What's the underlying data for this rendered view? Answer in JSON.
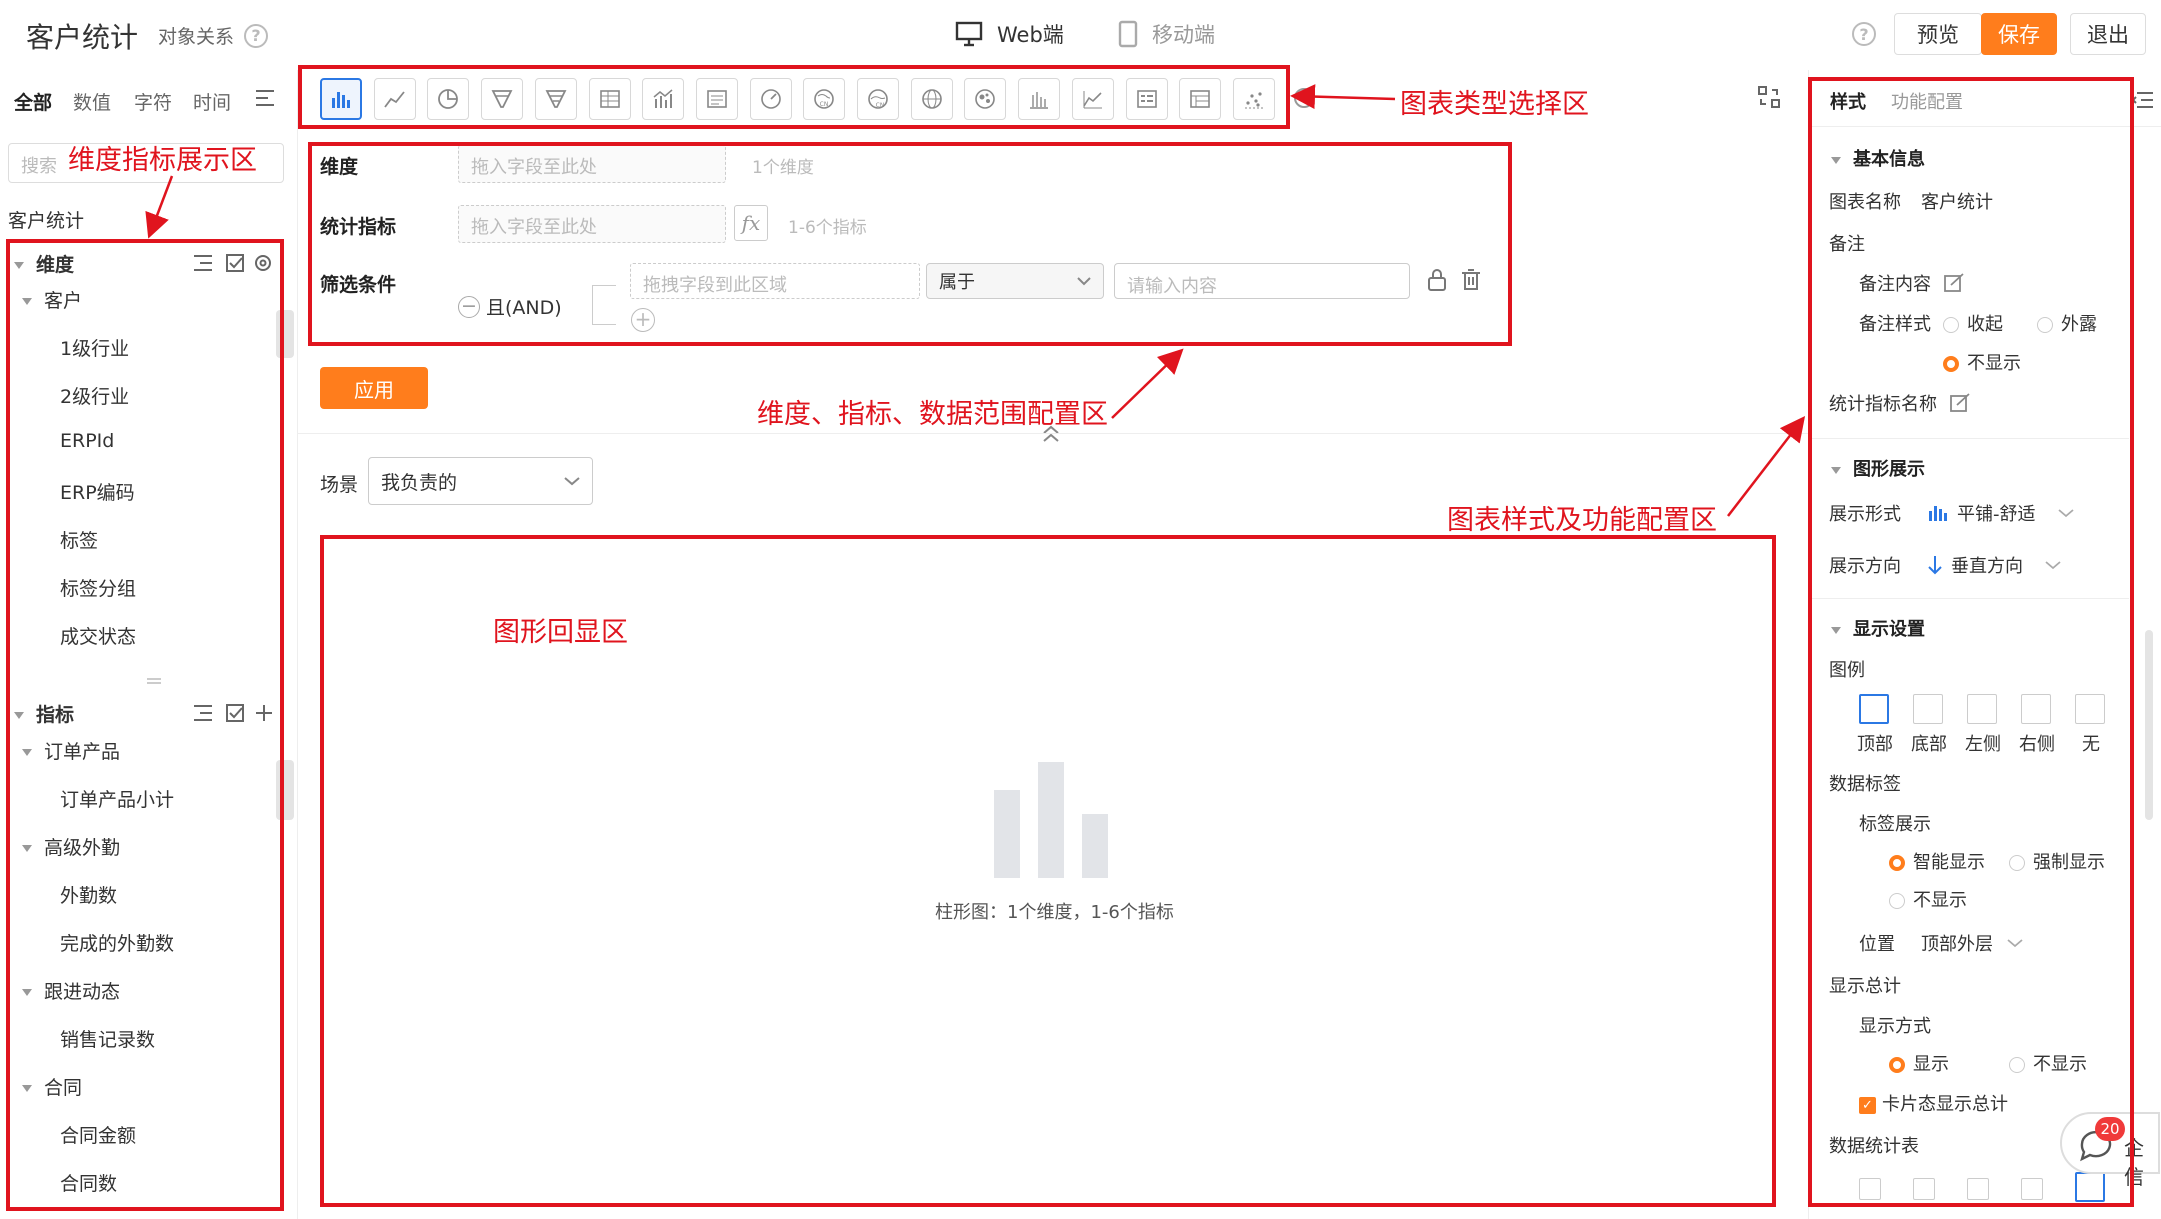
{
  "header": {
    "title": "客户统计",
    "subtitle": "对象关系",
    "device_tabs": [
      {
        "label": "Web端"
      },
      {
        "label": "移动端"
      }
    ],
    "buttons": {
      "preview": "预览",
      "save": "保存",
      "exit": "退出"
    }
  },
  "left": {
    "tabs": [
      "全部",
      "数值",
      "字符",
      "时间"
    ],
    "search_placeholder": "搜索",
    "object_name": "客户统计",
    "dimension_header": "维度",
    "dimension_groups": [
      {
        "label": "客户",
        "items": [
          "1级行业",
          "2级行业",
          "ERPId",
          "ERP编码",
          "标签",
          "标签分组",
          "成交状态"
        ]
      }
    ],
    "metric_header": "指标",
    "metric_groups": [
      {
        "label": "订单产品",
        "items": [
          "订单产品小计"
        ]
      },
      {
        "label": "高级外勤",
        "items": [
          "外勤数",
          "完成的外勤数"
        ]
      },
      {
        "label": "跟进动态",
        "items": [
          "销售记录数"
        ]
      },
      {
        "label": "合同",
        "items": [
          "合同金额",
          "合同数"
        ]
      }
    ]
  },
  "chart_types": [
    "bar-chart-icon",
    "line-chart-icon",
    "pie-chart-icon",
    "funnel-icon",
    "funnel-alt-icon",
    "table-icon",
    "combo-chart-icon",
    "card-icon",
    "gauge-icon",
    "map-cn-icon",
    "map-cn2-icon",
    "globe-icon",
    "bubble-icon",
    "stacked-bar-icon",
    "area-chart-icon",
    "pivot-icon",
    "list-table-icon",
    "scatter-icon"
  ],
  "config": {
    "dimension_label": "维度",
    "dimension_placeholder": "拖入字段至此处",
    "dimension_hint": "1个维度",
    "metric_label": "统计指标",
    "metric_placeholder": "拖入字段至此处",
    "metric_hint": "1-6个指标",
    "filter_label": "筛选条件",
    "filter_logic": "且(AND)",
    "filter_field_placeholder": "拖拽字段到此区域",
    "filter_operator": "属于",
    "filter_value_placeholder": "请输入内容",
    "apply": "应用"
  },
  "display": {
    "scene_label": "场景",
    "scene_value": "我负责的",
    "placeholder_text": "柱形图：1个维度，1-6个指标"
  },
  "right": {
    "tabs": [
      "样式",
      "功能配置"
    ],
    "basic_info": "基本信息",
    "chart_name_label": "图表名称",
    "chart_name_value": "客户统计",
    "remark_label": "备注",
    "remark_content_label": "备注内容",
    "remark_style_label": "备注样式",
    "remark_style_options": [
      "收起",
      "外露",
      "不显示"
    ],
    "metric_name_label": "统计指标名称",
    "graphic_display": "图形展示",
    "display_form_label": "展示形式",
    "display_form_value": "平铺-舒适",
    "direction_label": "展示方向",
    "direction_value": "垂直方向",
    "display_settings": "显示设置",
    "legend_label": "图例",
    "legend_options": [
      "顶部",
      "底部",
      "左侧",
      "右侧",
      "无"
    ],
    "data_label": "数据标签",
    "label_display": "标签展示",
    "label_options": [
      "智能显示",
      "强制显示",
      "不显示"
    ],
    "position_label": "位置",
    "position_value": "顶部外层",
    "show_total": "显示总计",
    "display_mode": "显示方式",
    "display_mode_options": [
      "显示",
      "不显示"
    ],
    "card_total": "卡片态显示总计",
    "data_table": "数据统计表",
    "chat_label": "企信",
    "chat_badge": "20"
  },
  "annotations": {
    "chart_type_area": "图表类型选择区",
    "dim_metric_area": "维度指标展示区",
    "config_area": "维度、指标、数据范围配置区",
    "style_area": "图表样式及功能配置区",
    "display_area": "图形回显区"
  },
  "colors": {
    "accent": "#ff7d1c",
    "selected": "#2b78e4",
    "annotation": "#e0141e"
  }
}
